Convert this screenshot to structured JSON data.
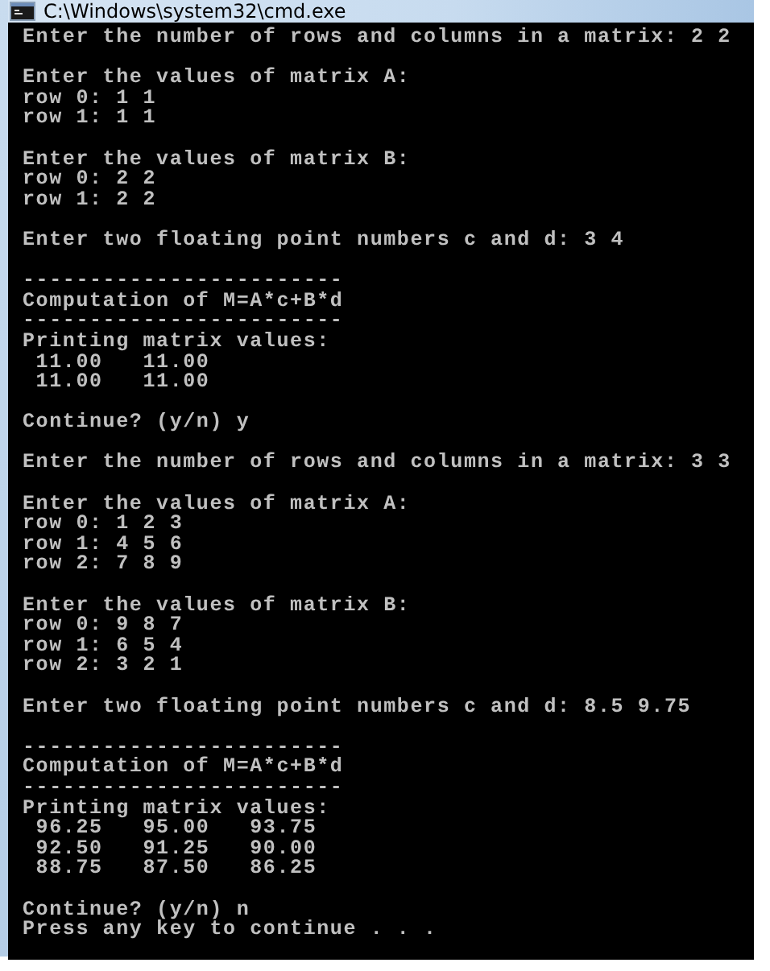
{
  "window": {
    "title": "C:\\Windows\\system32\\cmd.exe"
  },
  "console": {
    "blocks": [
      [
        "Enter the number of rows and columns in a matrix: 2 2"
      ],
      [
        "Enter the values of matrix A:",
        "row 0: 1 1",
        "row 1: 1 1"
      ],
      [
        "Enter the values of matrix B:",
        "row 0: 2 2",
        "row 1: 2 2"
      ],
      [
        "Enter two floating point numbers c and d: 3 4"
      ],
      [
        "------------------------",
        "Computation of M=A*c+B*d",
        "------------------------",
        "Printing matrix values:",
        " 11.00   11.00",
        " 11.00   11.00"
      ],
      [
        "Continue? (y/n) y"
      ],
      [
        "Enter the number of rows and columns in a matrix: 3 3"
      ],
      [
        "Enter the values of matrix A:",
        "row 0: 1 2 3",
        "row 1: 4 5 6",
        "row 2: 7 8 9"
      ],
      [
        "Enter the values of matrix B:",
        "row 0: 9 8 7",
        "row 1: 6 5 4",
        "row 2: 3 2 1"
      ],
      [
        "Enter two floating point numbers c and d: 8.5 9.75"
      ],
      [
        "------------------------",
        "Computation of M=A*c+B*d",
        "------------------------",
        "Printing matrix values:",
        " 96.25   95.00   93.75",
        " 92.50   91.25   90.00",
        " 88.75   87.50   86.25"
      ],
      [
        "Continue? (y/n) n",
        "Press any key to continue . . ."
      ]
    ]
  }
}
